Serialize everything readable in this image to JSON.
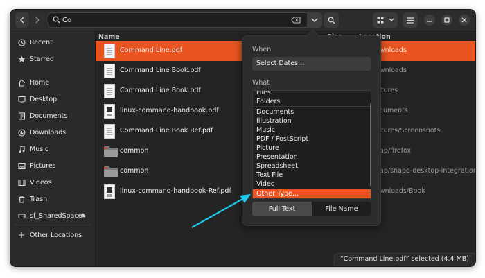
{
  "search": {
    "value": "Co"
  },
  "sidebar": {
    "items": [
      {
        "label": "Recent",
        "icon": "recent-icon"
      },
      {
        "label": "Starred",
        "icon": "star-icon"
      },
      {
        "label": "Home",
        "icon": "home-icon"
      },
      {
        "label": "Desktop",
        "icon": "desktop-icon"
      },
      {
        "label": "Documents",
        "icon": "documents-icon"
      },
      {
        "label": "Downloads",
        "icon": "downloads-icon"
      },
      {
        "label": "Music",
        "icon": "music-icon"
      },
      {
        "label": "Pictures",
        "icon": "pictures-icon"
      },
      {
        "label": "Videos",
        "icon": "videos-icon"
      },
      {
        "label": "Trash",
        "icon": "trash-icon"
      }
    ],
    "drive": {
      "label": "sf_SharedSpace",
      "icon": "drive-icon"
    },
    "other": {
      "label": "Other Locations",
      "icon": "plus-icon"
    }
  },
  "list": {
    "columns": {
      "name": "Name",
      "size": "Size",
      "location": "Location"
    },
    "rows": [
      {
        "name": "Command Line.pdf",
        "location": "ownloads",
        "thumb": "document",
        "selected": true
      },
      {
        "name": "Command Line Book.pdf",
        "location": "ownloads",
        "thumb": "document"
      },
      {
        "name": "Command Line Book.pdf",
        "location": "ictures",
        "thumb": "document"
      },
      {
        "name": "linux-command-handbook.pdf",
        "location": "ocuments",
        "thumb": "book"
      },
      {
        "name": "Command Line Book Ref.pdf",
        "location": "ictures/Screenshots",
        "thumb": "document"
      },
      {
        "name": "common",
        "location": "nap/firefox",
        "thumb": "folder"
      },
      {
        "name": "common",
        "location": "nap/snapd-desktop-integration",
        "thumb": "folder"
      },
      {
        "name": "linux-command-handbook-Ref.pdf",
        "location": "ownloads/Book",
        "thumb": "book"
      }
    ]
  },
  "popover": {
    "when_label": "When",
    "select_dates": "Select Dates…",
    "what_label": "What",
    "types": [
      "Files",
      "Folders",
      "Documents",
      "Illustration",
      "Music",
      "PDF / PostScript",
      "Picture",
      "Presentation",
      "Spreadsheet",
      "Text File",
      "Video",
      "Other Type…"
    ],
    "highlighted": "Other Type…",
    "full_text": "Full Text",
    "file_name": "File Name"
  },
  "status": {
    "text": "“Command Line.pdf” selected  (4.4 MB)"
  },
  "colors": {
    "accent": "#e95420",
    "annotation_arrow": "#1ec8e8"
  }
}
